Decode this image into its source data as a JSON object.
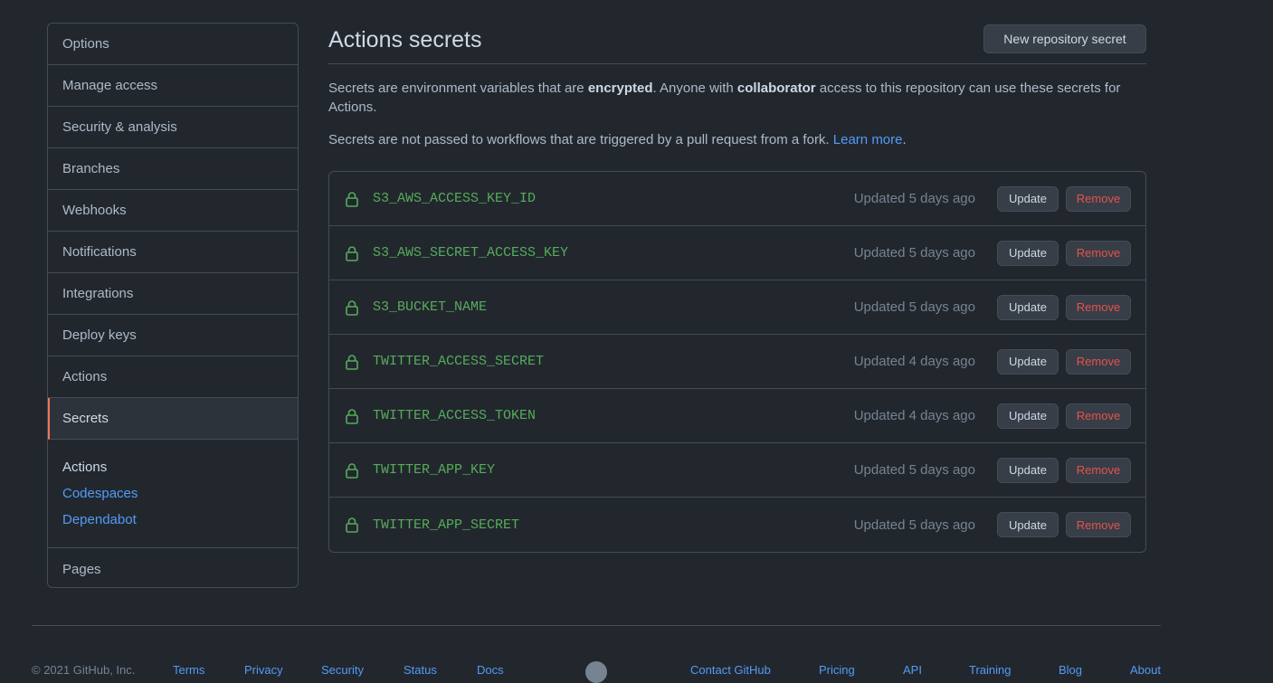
{
  "sidebar": {
    "items": [
      {
        "label": "Options"
      },
      {
        "label": "Manage access"
      },
      {
        "label": "Security & analysis"
      },
      {
        "label": "Branches"
      },
      {
        "label": "Webhooks"
      },
      {
        "label": "Notifications"
      },
      {
        "label": "Integrations"
      },
      {
        "label": "Deploy keys"
      },
      {
        "label": "Actions"
      },
      {
        "label": "Secrets"
      }
    ],
    "group": {
      "heading": "Actions",
      "links": [
        "Codespaces",
        "Dependabot"
      ]
    },
    "last_item": "Pages"
  },
  "main": {
    "title": "Actions secrets",
    "new_secret_button": "New repository secret",
    "desc": {
      "part1": "Secrets are environment variables that are ",
      "bold1": "encrypted",
      "part2": ". Anyone with ",
      "bold2": "collaborator",
      "part3": " access to this repository can use these secrets for Actions."
    },
    "desc2": {
      "text": "Secrets are not passed to workflows that are triggered by a pull request from a fork. ",
      "link": "Learn more",
      "end": "."
    },
    "secrets": [
      {
        "name": "S3_AWS_ACCESS_KEY_ID",
        "updated": "Updated 5 days ago"
      },
      {
        "name": "S3_AWS_SECRET_ACCESS_KEY",
        "updated": "Updated 5 days ago"
      },
      {
        "name": "S3_BUCKET_NAME",
        "updated": "Updated 5 days ago"
      },
      {
        "name": "TWITTER_ACCESS_SECRET",
        "updated": "Updated 4 days ago"
      },
      {
        "name": "TWITTER_ACCESS_TOKEN",
        "updated": "Updated 4 days ago"
      },
      {
        "name": "TWITTER_APP_KEY",
        "updated": "Updated 5 days ago"
      },
      {
        "name": "TWITTER_APP_SECRET",
        "updated": "Updated 5 days ago"
      }
    ],
    "update_label": "Update",
    "remove_label": "Remove",
    "icon": "lock-icon"
  },
  "footer": {
    "copyright": "© 2021 GitHub, Inc.",
    "links": [
      "Terms",
      "Privacy",
      "Security",
      "Status",
      "Docs",
      "Contact GitHub",
      "Pricing",
      "API",
      "Training",
      "Blog",
      "About"
    ],
    "logo_icon": "github-mark-icon"
  },
  "colors": {
    "background": "#22272e",
    "accent_link": "#539bf5",
    "secret_name": "#57ab5a",
    "remove": "#e5534b",
    "active_border": "#ec775c"
  }
}
